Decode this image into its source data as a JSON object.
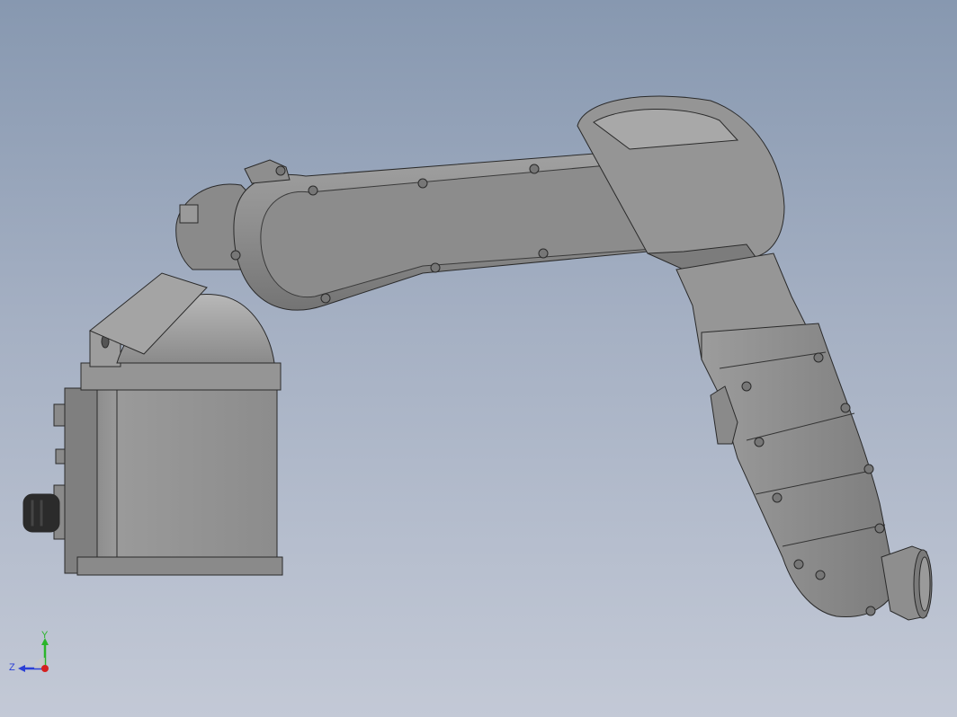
{
  "viewport": {
    "background_top": "#8798b0",
    "background_bottom": "#c3c9d6"
  },
  "model": {
    "body_color": "#8f8f8f",
    "shadow_color": "#6e6e6e",
    "highlight_color": "#b4b4b4",
    "edge_color": "#2a2a2a"
  },
  "triad": {
    "y_label": "Y",
    "z_label": "Z",
    "y_color": "#2bb52b",
    "z_color": "#2a3fd6",
    "x_color": "#d42020"
  }
}
